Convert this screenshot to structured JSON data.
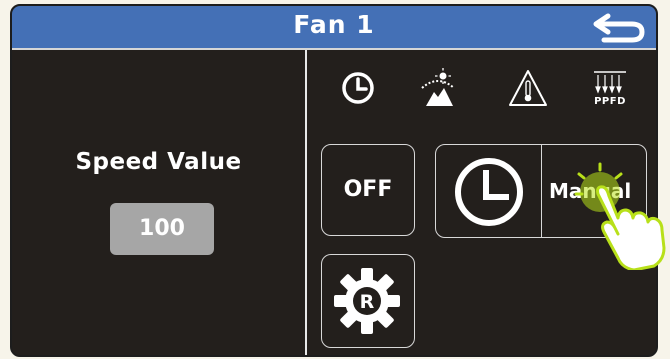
{
  "header": {
    "title": "Fan 1",
    "back_icon": "return-arrow-icon"
  },
  "left_panel": {
    "speed_label": "Speed Value",
    "speed_value": "100"
  },
  "mode_icons": [
    {
      "name": "clock-mode-icon"
    },
    {
      "name": "sunrise-mode-icon"
    },
    {
      "name": "temperature-mode-icon"
    },
    {
      "name": "ppfd-mode-icon",
      "label": "PPFD"
    }
  ],
  "controls": {
    "off_label": "OFF",
    "timer_icon": "clock-icon",
    "manual_label": "Manual",
    "reset_icon": "gear-r-icon",
    "reset_letter": "R"
  },
  "colors": {
    "header": "#4470b6",
    "panel": "#231f1c",
    "value_box": "#a6a6a6",
    "touch_hint": "#b8e01a"
  }
}
